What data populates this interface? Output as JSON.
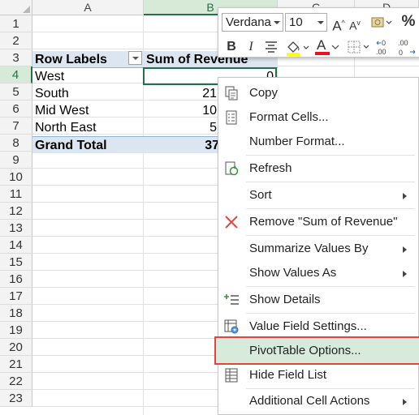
{
  "sheet": {
    "columns": [
      "A",
      "B",
      "C",
      "D"
    ],
    "rows": [
      "1",
      "2",
      "3",
      "4",
      "5",
      "6",
      "7",
      "8",
      "9",
      "10",
      "11",
      "12",
      "13",
      "14",
      "15",
      "16",
      "17",
      "18",
      "19",
      "20",
      "21",
      "22",
      "23"
    ],
    "pivot": {
      "header": {
        "label": "Row Labels",
        "value": "Sum of Revenue"
      },
      "rows": [
        {
          "label": "West",
          "value": "0"
        },
        {
          "label": "South",
          "value": "21"
        },
        {
          "label": "Mid West",
          "value": "10"
        },
        {
          "label": "North East",
          "value": "5"
        }
      ],
      "total": {
        "label": "Grand Total",
        "value": "37"
      }
    }
  },
  "mini_toolbar": {
    "font_name": "Verdana",
    "font_size": "10",
    "grow_label": "A",
    "shrink_label": "A",
    "percent_label": "%",
    "bold_label": "B",
    "italic_label": "I",
    "font_color_label": "A",
    "inc_decimal_label": "←0 .00",
    "dec_decimal_label": ".00 →0"
  },
  "context_menu": {
    "items": [
      {
        "label": "Copy",
        "icon": "copy-icon"
      },
      {
        "label": "Format Cells...",
        "icon": "format-cells-icon"
      },
      {
        "label": "Number Format...",
        "icon": ""
      },
      {
        "label": "Refresh",
        "icon": "refresh-icon"
      },
      {
        "label": "Sort",
        "icon": ""
      },
      {
        "label": "Remove \"Sum of Revenue\"",
        "icon": "remove-x-icon"
      },
      {
        "label": "Summarize Values By",
        "icon": ""
      },
      {
        "label": "Show Values As",
        "icon": ""
      },
      {
        "label": "Show Details",
        "icon": "show-details-icon"
      },
      {
        "label": "Value Field Settings...",
        "icon": "field-settings-icon"
      },
      {
        "label": "PivotTable Options...",
        "icon": ""
      },
      {
        "label": "Hide Field List",
        "icon": "field-list-icon"
      },
      {
        "label": "Additional Cell Actions",
        "icon": ""
      }
    ]
  },
  "colors": {
    "excel_green": "#217346",
    "pivot_header": "#dce6f1",
    "highlight": "#d7ebdd",
    "highlight_border": "#e8413f"
  }
}
